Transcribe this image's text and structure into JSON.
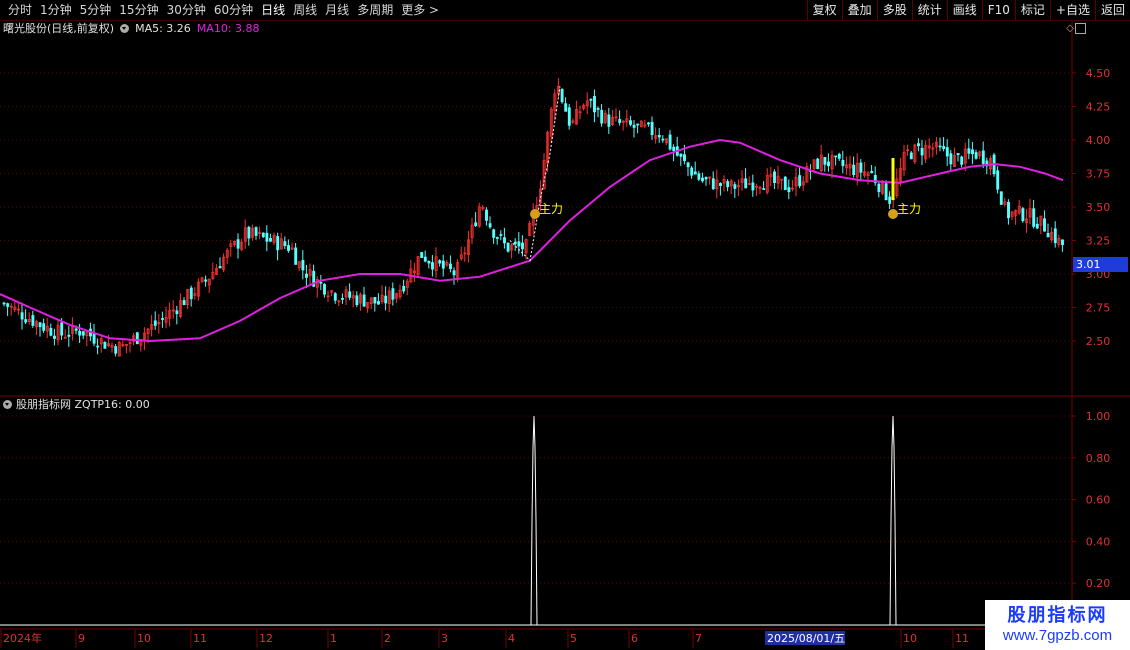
{
  "toolbar": {
    "periods": [
      "分时",
      "1分钟",
      "5分钟",
      "15分钟",
      "30分钟",
      "60分钟",
      "日线",
      "周线",
      "月线",
      "多周期",
      "更多 >"
    ],
    "active_period": "日线",
    "right_buttons": [
      "复权",
      "叠加",
      "多股",
      "统计",
      "画线",
      "F10",
      "标记",
      "+自选",
      "返回"
    ]
  },
  "main_panel": {
    "stock_label": "曙光股份(日线,前复权)",
    "ma5_label": "MA5: 3.26",
    "ma10_label": "MA10: 3.88",
    "y_ticks": [
      "4.50",
      "4.25",
      "4.00",
      "3.75",
      "3.50",
      "3.25",
      "3.00",
      "2.75",
      "2.50"
    ],
    "current_price": "3.01",
    "signal_label": "主力"
  },
  "sub_panel": {
    "indicator_label": "股朋指标网 ZQTP16: 0.00",
    "y_ticks": [
      "1.00",
      "0.80",
      "0.60",
      "0.40",
      "0.20"
    ]
  },
  "x_axis": {
    "labels": [
      "2024年",
      "9",
      "10",
      "11",
      "12",
      "1",
      "2",
      "3",
      "4",
      "5",
      "6",
      "7",
      "10",
      "11"
    ],
    "cursor_date": "2025/08/01/五"
  },
  "watermark": {
    "line1": "股朋指标网",
    "line2": "www.7gpzb.com"
  },
  "colors": {
    "up": "#ff3232",
    "down": "#54ffff",
    "ma": "#e020e0",
    "grid": "#7a0000",
    "signal": "#ffff00"
  }
}
